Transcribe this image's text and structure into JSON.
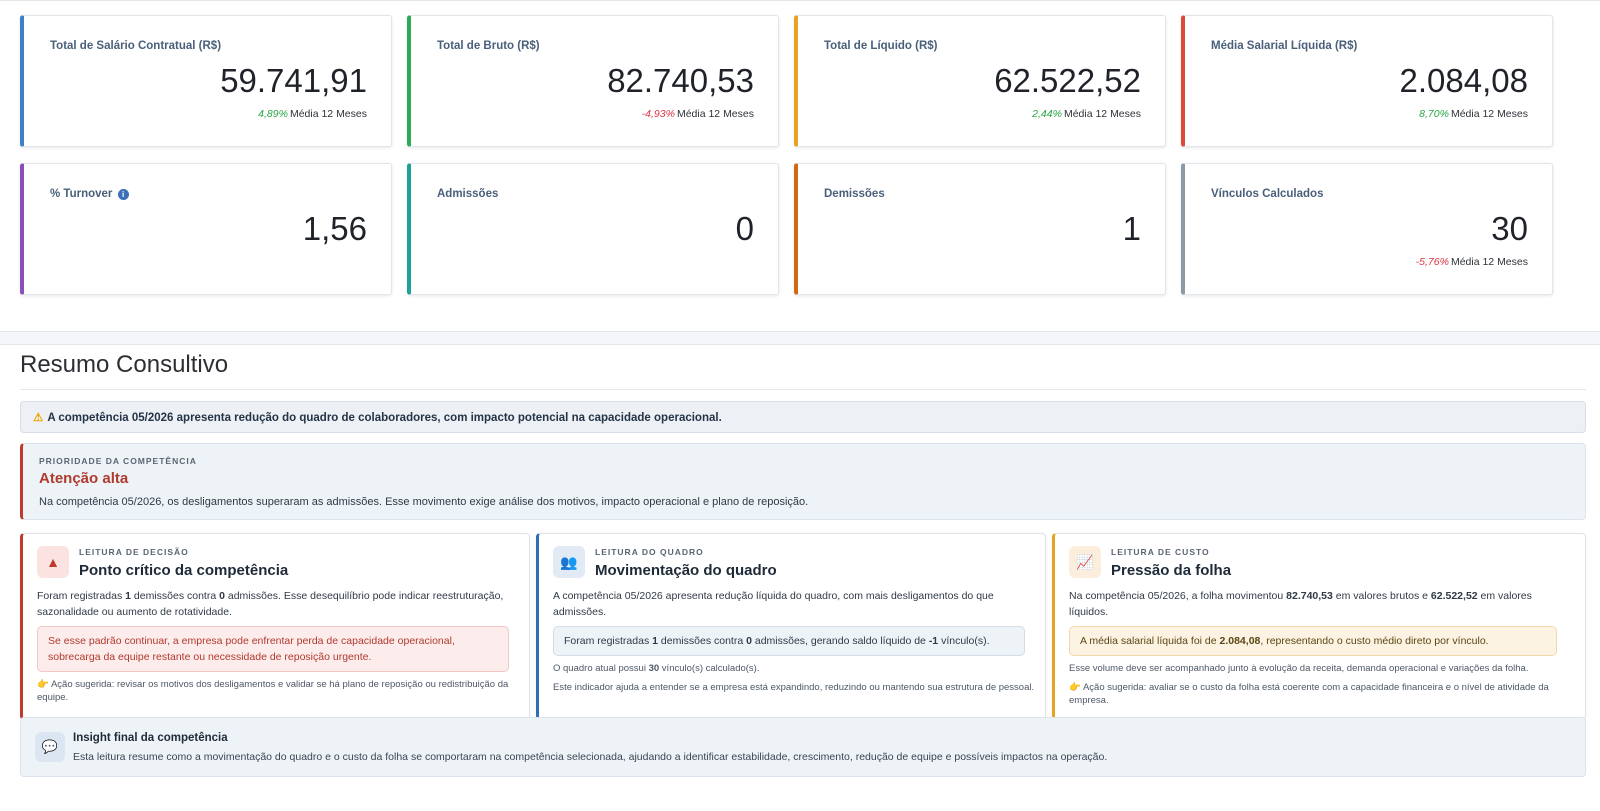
{
  "kpis": [
    {
      "label": "Total de Salário Contratual (R$)",
      "value": "59.741,91",
      "pct": "4,89%",
      "pct_dir": "pos",
      "trend_text": "Média 12 Meses",
      "color": "#3b82c4"
    },
    {
      "label": "Total de Bruto (R$)",
      "value": "82.740,53",
      "pct": "-4,93%",
      "pct_dir": "neg",
      "trend_text": "Média 12 Meses",
      "color": "#2eaa5c"
    },
    {
      "label": "Total de Líquido (R$)",
      "value": "62.522,52",
      "pct": "2,44%",
      "pct_dir": "pos",
      "trend_text": "Média 12 Meses",
      "color": "#e5a224"
    },
    {
      "label": "Média Salarial Líquida (R$)",
      "value": "2.084,08",
      "pct": "8,70%",
      "pct_dir": "pos",
      "trend_text": "Média 12 Meses",
      "color": "#dc4a3d"
    },
    {
      "label": "% Turnover",
      "value": "1,56",
      "color": "#8a4fb8",
      "info_icon": "info-circle-icon"
    },
    {
      "label": "Admissões",
      "value": "0",
      "color": "#1fa195"
    },
    {
      "label": "Demissões",
      "value": "1",
      "color": "#d06a12"
    },
    {
      "label": "Vínculos Calculados",
      "value": "30",
      "pct": "-5,76%",
      "pct_dir": "neg",
      "trend_text": "Média 12 Meses",
      "color": "#8b9aa6"
    }
  ],
  "summary": {
    "title": "Resumo Consultivo",
    "alert": "A competência 05/2026 apresenta redução do quadro de colaboradores, com impacto potencial na capacidade operacional.",
    "priority": {
      "kicker": "PRIORIDADE DA COMPETÊNCIA",
      "heading": "Atenção alta",
      "text": "Na competência 05/2026, os desligamentos superaram as admissões. Esse movimento exige análise dos motivos, impacto operacional e plano de reposição."
    },
    "decision": {
      "kicker": "LEITURA DE DECISÃO",
      "heading": "Ponto crítico da competência",
      "p1_a": "Foram registradas ",
      "p1_b": "1",
      "p1_c": " demissões contra ",
      "p1_d": "0",
      "p1_e": " admissões. Esse desequilíbrio pode indicar reestruturação, sazonalidade ou aumento de rotatividade.",
      "box": "Se esse padrão continuar, a empresa pode enfrentar perda de capacidade operacional, sobrecarga da equipe restante ou necessidade de reposição urgente.",
      "action": "Ação sugerida: revisar os motivos dos desligamentos e validar se há plano de reposição ou redistribuição da equipe."
    },
    "quadro": {
      "kicker": "LEITURA DO QUADRO",
      "heading": "Movimentação do quadro",
      "p1": "A competência 05/2026 apresenta redução líquida do quadro, com mais desligamentos do que admissões.",
      "box_a": "Foram registradas ",
      "box_b": "1",
      "box_c": " demissões contra ",
      "box_d": "0",
      "box_e": " admissões, gerando saldo líquido de ",
      "box_f": "-1",
      "box_g": " vínculo(s).",
      "s1_a": "O quadro atual possui ",
      "s1_b": "30",
      "s1_c": " vínculo(s) calculado(s).",
      "s2": "Este indicador ajuda a entender se a empresa está expandindo, reduzindo ou mantendo sua estrutura de pessoal."
    },
    "custo": {
      "kicker": "LEITURA DE CUSTO",
      "heading": "Pressão da folha",
      "p1_a": "Na competência 05/2026, a folha movimentou ",
      "p1_b": "82.740,53",
      "p1_c": " em valores brutos e ",
      "p1_d": "62.522,52",
      "p1_e": " em valores líquidos.",
      "box_a": "A média salarial líquida foi de ",
      "box_b": "2.084,08",
      "box_c": ", representando o custo médio direto por vínculo.",
      "s1": "Esse volume deve ser acompanhado junto à evolução da receita, demanda operacional e variações da folha.",
      "action": "Ação sugerida: avaliar se o custo da folha está coerente com a capacidade financeira e o nível de atividade da empresa."
    },
    "insight": {
      "heading": "Insight final da competência",
      "text": "Esta leitura resume como a movimentação do quadro e o custo da folha se comportaram na competência selecionada, ajudando a identificar estabilidade, crescimento, redução de equipe e possíveis impactos na operação."
    }
  }
}
